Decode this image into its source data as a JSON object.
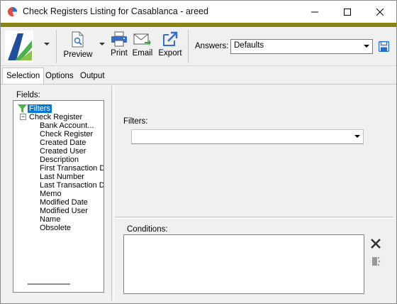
{
  "window": {
    "title": "Check Registers Listing for Casablanca - areed"
  },
  "toolbar": {
    "preview_label": "Preview",
    "print_label": "Print",
    "email_label": "Email",
    "export_label": "Export",
    "answers_label": "Answers:",
    "answers_value": "Defaults"
  },
  "tabs": [
    {
      "label": "Selection"
    },
    {
      "label": "Options"
    },
    {
      "label": "Output"
    }
  ],
  "selection": {
    "fields_label": "Fields:",
    "tree": {
      "filters": "Filters",
      "group": "Check Register",
      "expander": "−",
      "items": [
        "Bank Account...",
        "Check Register",
        "Created Date",
        "Created User",
        "Description",
        "First Transaction D",
        "Last Number",
        "Last Transaction D",
        "Memo",
        "Modified Date",
        "Modified User",
        "Name",
        "Obsolete"
      ]
    },
    "filters_label": "Filters:",
    "filters_value": "",
    "conditions_label": "Conditions:"
  },
  "colors": {
    "accent_olive": "#8a8414",
    "selection_blue": "#0078d7",
    "brand_blue": "#1f4e9c",
    "brand_green": "#4caf50"
  },
  "icons": {
    "app": "pie-chart-icon",
    "logo": "acctivate-logo",
    "preview": "preview-document-icon",
    "print": "printer-icon",
    "email": "envelope-icon",
    "export": "export-arrow-icon",
    "save": "floppy-disk-icon",
    "filter": "funnel-icon",
    "close": "close-icon",
    "condition_action": "column-move-icon"
  }
}
